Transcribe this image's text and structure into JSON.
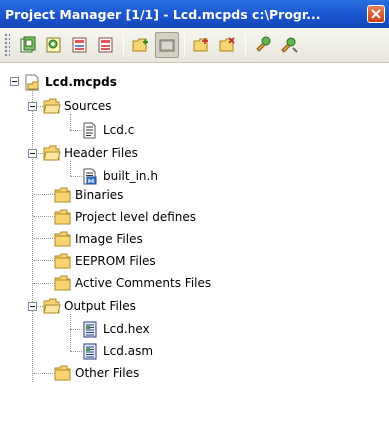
{
  "titlebar": {
    "title": "Project Manager [1/1] - Lcd.mcpds  c:\\Progr..."
  },
  "tree": {
    "root": "Lcd.mcpds",
    "nodes": {
      "sources": "Sources",
      "lcd_c": "Lcd.c",
      "header_files": "Header Files",
      "built_in_h": "built_in.h",
      "binaries": "Binaries",
      "project_defines": "Project level defines",
      "image_files": "Image Files",
      "eeprom_files": "EEPROM Files",
      "active_comments": "Active Comments Files",
      "output_files": "Output Files",
      "lcd_hex": "Lcd.hex",
      "lcd_asm": "Lcd.asm",
      "other_files": "Other Files"
    }
  },
  "colors": {
    "titlebar": "#1a55cf",
    "folder": "#f6d572",
    "close": "#d2532a"
  }
}
